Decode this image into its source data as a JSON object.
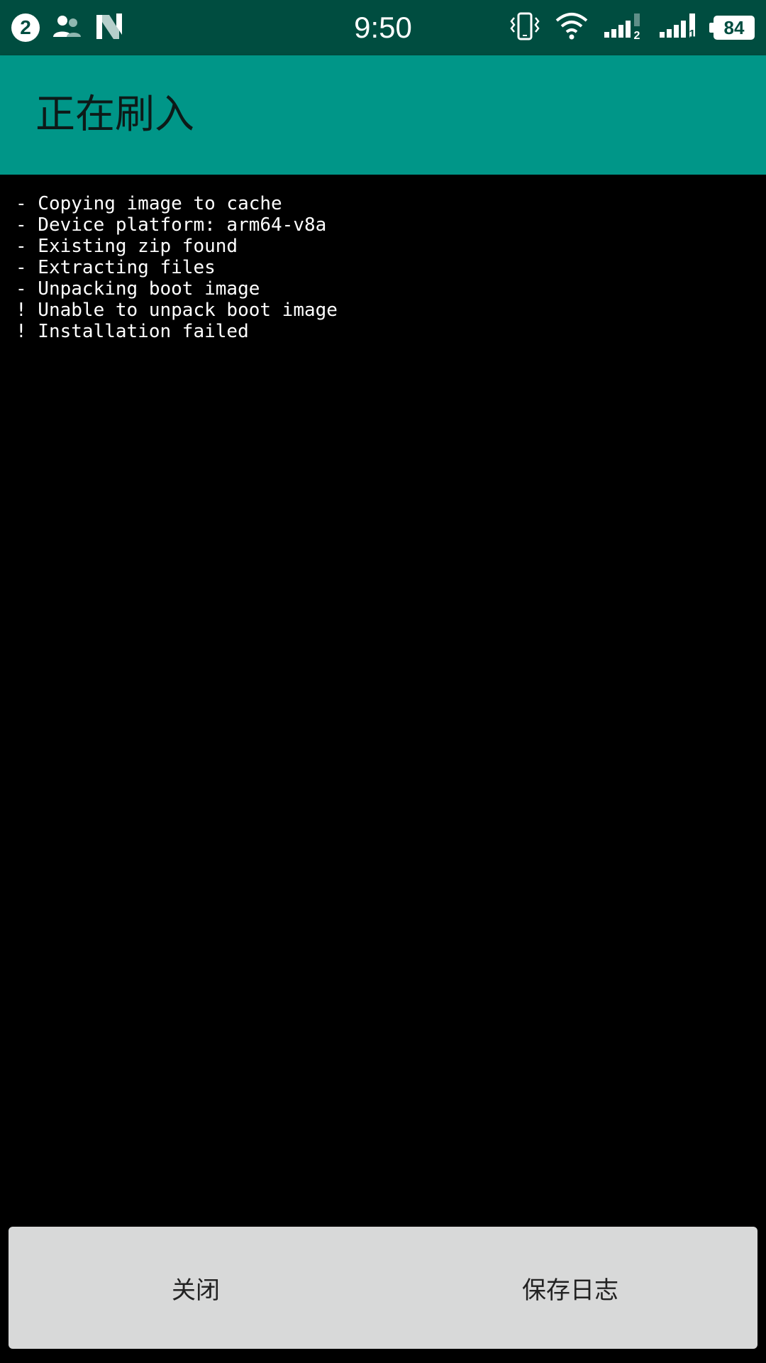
{
  "status_bar": {
    "notification_count": "2",
    "time": "9:50",
    "battery_level": "84",
    "sim1_label": "2",
    "sim2_label": "1",
    "icons": [
      "notification-count-icon",
      "contacts-icon",
      "n-app-icon",
      "vibrate-icon",
      "wifi-icon",
      "signal-icon",
      "signal-icon",
      "battery-icon"
    ],
    "colors": {
      "background": "#004d40",
      "foreground": "#ffffff"
    }
  },
  "app_bar": {
    "title": "正在刷入",
    "color": "#009688"
  },
  "console": {
    "lines": [
      "- Copying image to cache",
      "- Device platform: arm64-v8a",
      "- Existing zip found",
      "- Extracting files",
      "- Unpacking boot image",
      "! Unable to unpack boot image",
      "! Installation failed"
    ]
  },
  "actions": {
    "close_label": "关闭",
    "save_log_label": "保存日志"
  }
}
